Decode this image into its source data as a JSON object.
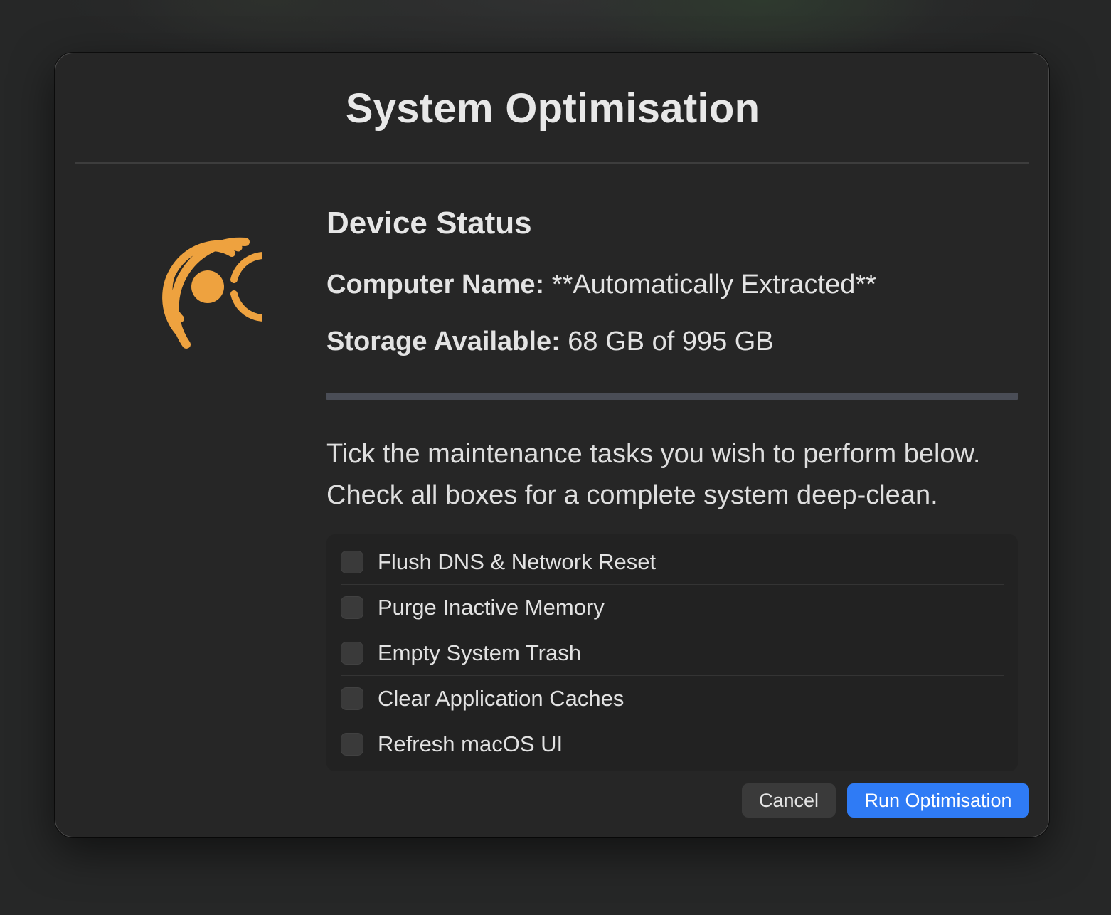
{
  "dialog": {
    "title": "System Optimisation"
  },
  "status": {
    "heading": "Device Status",
    "computer_name_label": "Computer Name:",
    "computer_name_value": "**Automatically Extracted**",
    "storage_label": "Storage Available:",
    "storage_value": "68 GB of 995 GB",
    "storage_available_fraction": 0.068
  },
  "instructions": {
    "line1": "Tick the maintenance tasks you wish to perform below.",
    "line2": "Check all boxes for a complete system deep-clean."
  },
  "tasks": [
    {
      "label": "Flush DNS & Network Reset",
      "checked": false
    },
    {
      "label": "Purge Inactive Memory",
      "checked": false
    },
    {
      "label": "Empty System Trash",
      "checked": false
    },
    {
      "label": "Clear Application Caches",
      "checked": false
    },
    {
      "label": "Refresh macOS UI",
      "checked": false
    }
  ],
  "buttons": {
    "cancel": "Cancel",
    "run": "Run Optimisation"
  },
  "colors": {
    "accent": "#2f7bf5",
    "logo": "#eea23f",
    "background": "#262626"
  },
  "icons": {
    "logo": "concentric-arcs-logo-icon"
  }
}
